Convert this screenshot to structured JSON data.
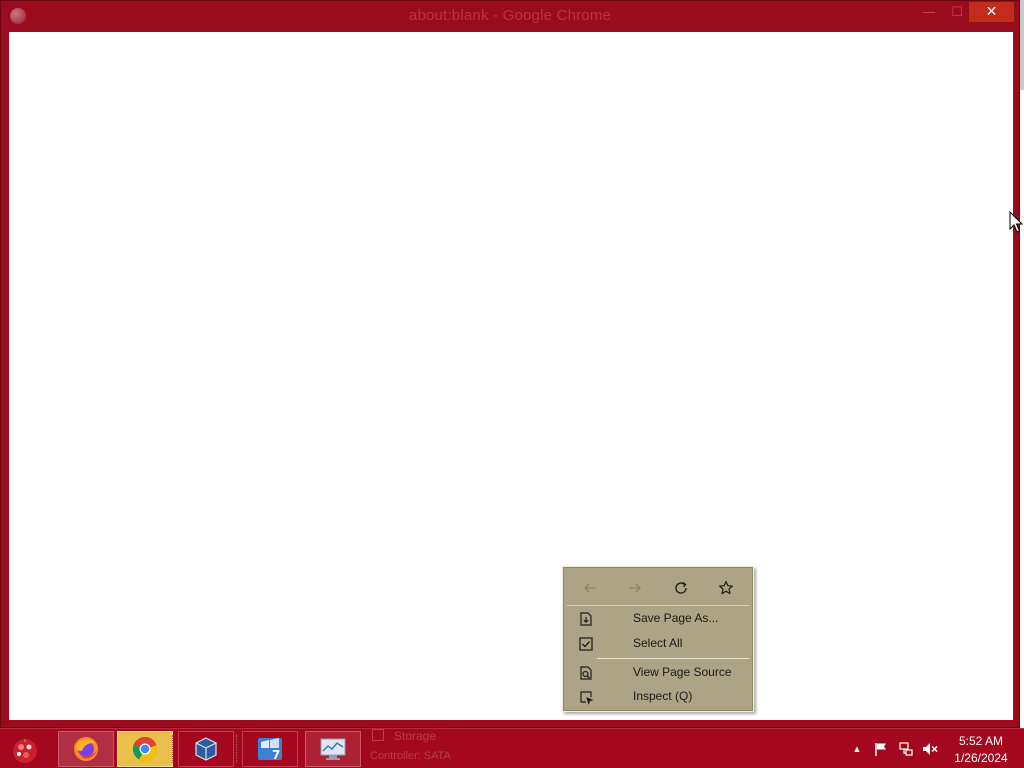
{
  "window": {
    "title": "about:blank - Google Chrome",
    "minimize_glyph": "—",
    "maximize_glyph": "☐",
    "close_glyph": "✕",
    "faint_line1": "",
    "faint_line2": ""
  },
  "context_menu": {
    "nav": {
      "back_icon": "arrow-left-icon",
      "forward_icon": "arrow-right-icon",
      "reload_icon": "reload-icon",
      "bookmark_icon": "star-icon"
    },
    "items": [
      {
        "label": "Save Page As...",
        "icon": "save-page-icon"
      },
      {
        "label": "Select All",
        "icon": "checkbox-icon"
      },
      {
        "label": "View Page Source",
        "icon": "page-source-icon"
      },
      {
        "label": "Inspect (Q)",
        "icon": "inspect-icon"
      }
    ]
  },
  "taskbar": {
    "apps": [
      {
        "name": "Firefox",
        "icon": "firefox-icon"
      },
      {
        "name": "Google Chrome",
        "icon": "chrome-icon"
      },
      {
        "name": "VirtualBox",
        "icon": "virtualbox-icon"
      },
      {
        "name": "Windows 7",
        "icon": "windows7-icon"
      },
      {
        "name": "Performance Monitor",
        "icon": "performance-monitor-icon"
      }
    ],
    "ghost_text": {
      "storage": "Storage",
      "controller": "Controller: SATA"
    },
    "tray": {
      "up_arrow": "▲",
      "flag_icon": "action-center-flag-icon",
      "network_icon": "network-icon",
      "volume_icon": "volume-muted-icon"
    },
    "clock": {
      "time": "5:52 AM",
      "date": "1/26/2024"
    }
  },
  "colors": {
    "desktop": "#a3081e",
    "menu_bg": "#ada485",
    "close_button": "#c42b1c"
  }
}
